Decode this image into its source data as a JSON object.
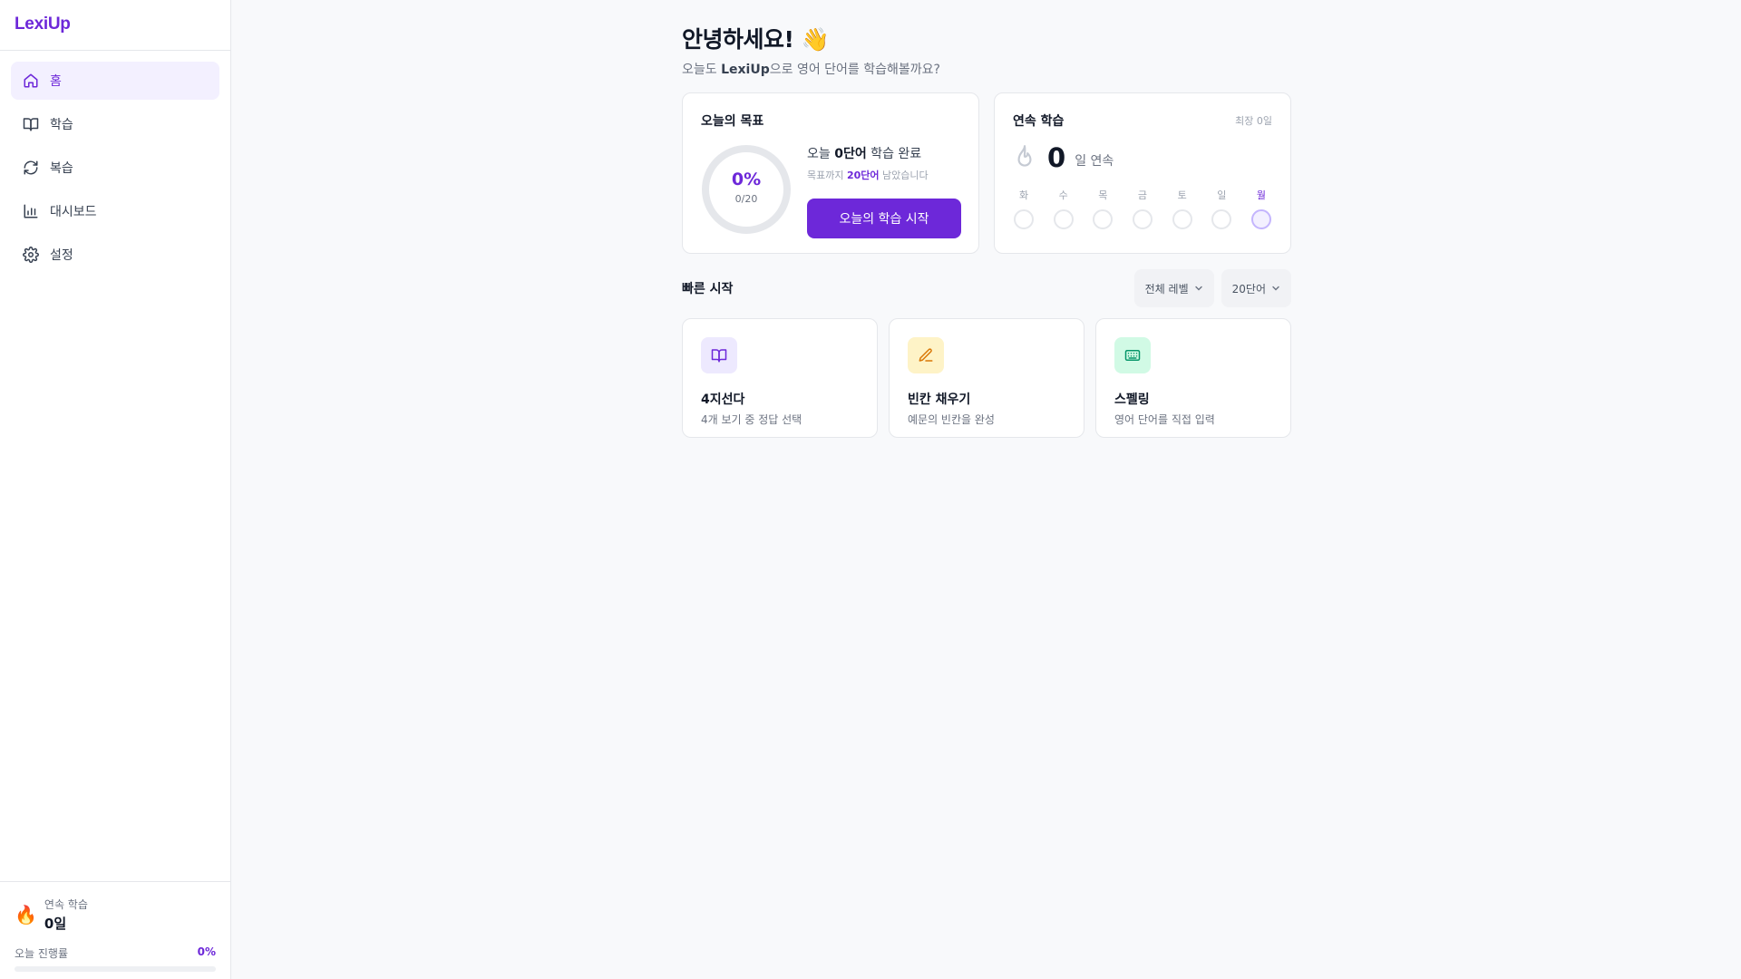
{
  "app": {
    "brand": "LexiUp"
  },
  "sidebar": {
    "items": [
      {
        "label": "홈",
        "icon": "home-icon",
        "active": true
      },
      {
        "label": "학습",
        "icon": "book-icon"
      },
      {
        "label": "복습",
        "icon": "refresh-icon"
      },
      {
        "label": "대시보드",
        "icon": "bar-chart-icon"
      },
      {
        "label": "설정",
        "icon": "gear-icon"
      }
    ],
    "footer": {
      "streak_label": "연속 학습",
      "streak_value": "0일",
      "progress_label": "오늘 진행률",
      "progress_value": "0%",
      "progress_fraction": 0
    }
  },
  "main": {
    "greeting": "안녕하세요! 👋",
    "subtitle_prefix": "오늘도 ",
    "subtitle_brand": "LexiUp",
    "subtitle_suffix": "으로 영어 단어를 학습해볼까요?",
    "goal": {
      "title": "오늘의 목표",
      "percent": "0%",
      "count": "0/20",
      "line1_prefix": "오늘 ",
      "line1_value": "0단어",
      "line1_suffix": " 학습 완료",
      "line2_prefix": "목표까지 ",
      "line2_value": "20단어",
      "line2_suffix": " 남았습니다",
      "button": "오늘의 학습 시작"
    },
    "streak": {
      "title": "연속 학습",
      "best": "최장 0일",
      "count": "0",
      "unit": "일 연속",
      "days": [
        "화",
        "수",
        "목",
        "금",
        "토",
        "일",
        "월"
      ]
    },
    "quick_start": {
      "title": "빠른 시작",
      "level_select": "전체 레벨",
      "count_select": "20단어",
      "modes": [
        {
          "title": "4지선다",
          "desc": "4개 보기 중 정답 선택",
          "icon": "book-open-icon",
          "bg": "#ede9fe",
          "fg": "#6d28d9"
        },
        {
          "title": "빈칸 채우기",
          "desc": "예문의 빈칸을 완성",
          "icon": "pencil-icon",
          "bg": "#fef3c7",
          "fg": "#d97706"
        },
        {
          "title": "스펠링",
          "desc": "영어 단어를 직접 입력",
          "icon": "keyboard-icon",
          "bg": "#d1fae5",
          "fg": "#059669"
        }
      ]
    }
  },
  "colors": {
    "accent": "#6d28d9",
    "accent_soft": "#f3f0ff"
  }
}
